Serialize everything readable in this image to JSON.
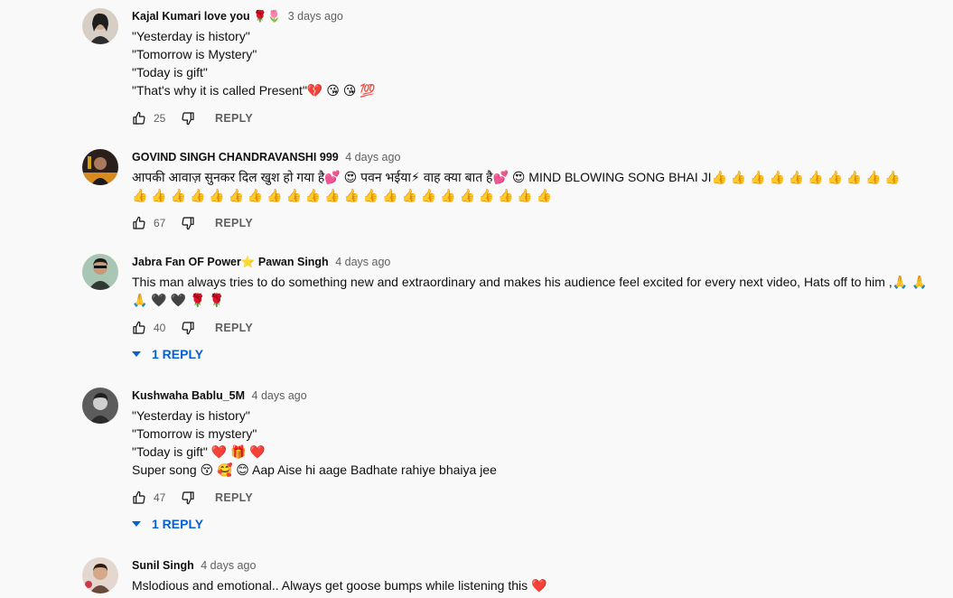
{
  "comments": [
    {
      "author": "Kajal Kumari love you 🌹🌷",
      "time": "3 days ago",
      "lines": [
        "\"Yesterday is history\"",
        "\"Tomorrow is Mystery\"",
        "\"Today is gift\"",
        "\"That's why it is called Present\"💔 😘 😘 💯"
      ],
      "likes": "25",
      "reply_label": "REPLY",
      "avatar_color": "#c9b8a6"
    },
    {
      "author": "GOVIND SINGH CHANDRAVANSHI 999",
      "time": "4 days ago",
      "lines": [
        "आपकी आवाज़ सुनकर दिल खुश हो गया है💕 😍  पवन भईया⚡  वाह क्या बात है💕 😍  MIND BLOWING SONG BHAI JI👍 👍 👍 👍 👍 👍 👍 👍 👍 👍",
        "👍 👍 👍 👍 👍 👍 👍 👍 👍 👍 👍 👍 👍 👍 👍 👍 👍 👍 👍 👍 👍 👍"
      ],
      "likes": "67",
      "reply_label": "REPLY",
      "avatar_color": "#3a2f2a"
    },
    {
      "author": "Jabra Fan OF Power⭐ Pawan Singh",
      "time": "4 days ago",
      "lines": [
        "This man always tries to do something new and extraordinary and makes his audience feel excited for every next video, Hats off to him ,🙏 🙏",
        "🙏 🖤 🖤 🌹 🌹"
      ],
      "likes": "40",
      "reply_label": "REPLY",
      "replies_label": "1 REPLY",
      "avatar_color": "#6f8f7a"
    },
    {
      "author": "Kushwaha Bablu_5M",
      "time": "4 days ago",
      "lines": [
        "\"Yesterday is history\"",
        "\"Tomorrow is mystery\"",
        "\"Today is gift\" ❤️ 🎁 ❤️",
        "Super song 😚 🥰 😊  Aap Aise hi aage Badhate rahiye bhaiya jee"
      ],
      "likes": "47",
      "reply_label": "REPLY",
      "replies_label": "1 REPLY",
      "avatar_color": "#4a4a4a"
    },
    {
      "author": "Sunil Singh",
      "time": "4 days ago",
      "lines": [
        "Mslodious and emotional.. Always get goose bumps while listening this  ❤️"
      ],
      "avatar_color": "#b98b6e"
    }
  ],
  "icons": {
    "like": "thumbs-up-icon",
    "dislike": "thumbs-down-icon",
    "replies_caret": "caret-down-icon"
  },
  "colors": {
    "link_blue": "#065fd4",
    "secondary_text": "#606060",
    "background": "#f9f9f9"
  }
}
